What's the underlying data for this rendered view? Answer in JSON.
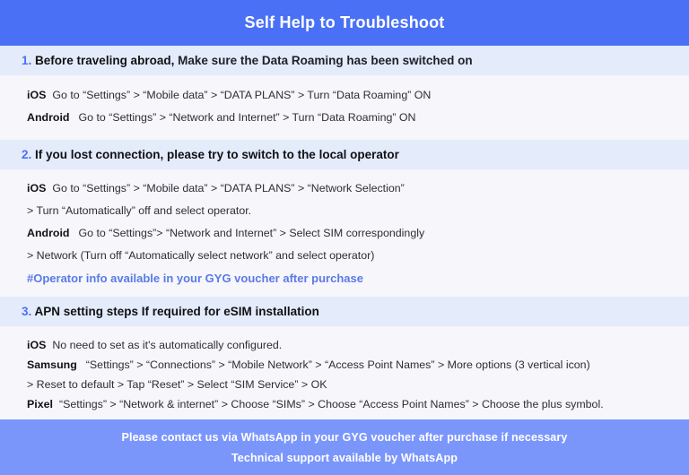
{
  "header": {
    "title": "Self Help to Troubleshoot",
    "bg_color": "#4a71f5",
    "text_color": "#ffffff"
  },
  "accent_color": "#4a71f5",
  "note_color": "#5b7ae6",
  "band_color": "#e4ebfb",
  "body_bg_color": "#f6f6fb",
  "sections": [
    {
      "number": "1.",
      "title_strong": "Before traveling abroad,",
      "title_rest": "Make sure the Data Roaming has been switched on",
      "lines": [
        {
          "platform": "iOS",
          "text": "Go to “Settings” > “Mobile data” > “DATA PLANS” > Turn “Data Roaming” ON"
        },
        {
          "platform": "Android",
          "text": "Go to “Settings” > “Network and Internet” > Turn “Data Roaming” ON"
        }
      ]
    },
    {
      "number": "2.",
      "title_strong": "If you lost connection, please try to switch to the local operator",
      "title_rest": "",
      "lines": [
        {
          "platform": "iOS",
          "text": "Go to “Settings” > “Mobile data” > “DATA PLANS” > “Network Selection”"
        },
        {
          "platform": "",
          "text": "> Turn “Automatically” off and select operator."
        },
        {
          "platform": "Android",
          "text": "Go to “Settings”>  “Network and Internet” > Select SIM correspondingly"
        },
        {
          "platform": "",
          "text": "> Network (Turn off “Automatically select network” and select operator)"
        }
      ],
      "note": "#Operator info available in your GYG voucher after purchase"
    },
    {
      "number": "3.",
      "title_strong": "APN setting steps If required for eSIM installation",
      "title_rest": "",
      "lines": [
        {
          "platform": "iOS",
          "text": "No need to set as it's automatically configured."
        },
        {
          "platform": "Samsung",
          "text": "“Settings” > “Connections” > “Mobile Network” > “Access Point Names” > More options (3 vertical icon)"
        },
        {
          "platform": "",
          "text": "> Reset to default > Tap “Reset” > Select “SIM Service” > OK"
        },
        {
          "platform": "Pixel",
          "text": "“Settings” > “Network & internet” > Choose “SIMs” > Choose “Access Point Names” > Choose the plus symbol."
        }
      ]
    }
  ],
  "footer": {
    "bg_color": "#7b96fb",
    "line1": "Please contact us via WhatsApp  in your GYG voucher after purchase if necessary",
    "line2": "Technical support available by WhatsApp"
  }
}
